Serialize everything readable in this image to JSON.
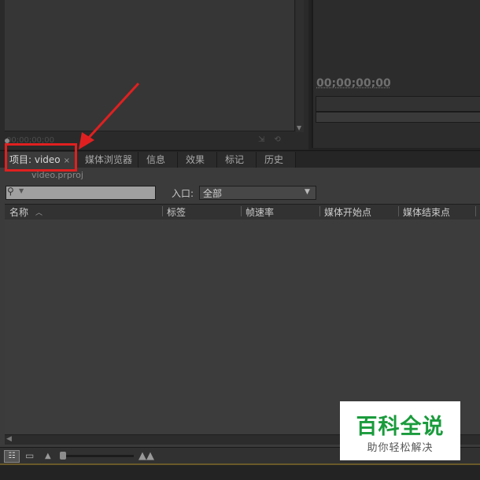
{
  "source_monitor": {
    "timecode": "00;00;00;00"
  },
  "program_monitor": {
    "timecode": "00;00;00;00"
  },
  "tabs": [
    {
      "label": "项目: video",
      "close": "×"
    },
    {
      "label": "媒体浏览器"
    },
    {
      "label": "信息"
    },
    {
      "label": "效果"
    },
    {
      "label": "标记"
    },
    {
      "label": "历史"
    }
  ],
  "project": {
    "file_name": "video.prproj",
    "search_placeholder": "",
    "entry_label": "入口:",
    "entry_value": "全部",
    "columns": [
      "名称",
      "标签",
      "帧速率",
      "媒体开始点",
      "媒体结束点"
    ]
  },
  "watermark": {
    "title": "百科全说",
    "subtitle": "助你轻松解决"
  },
  "colors": {
    "highlight": "#e02020",
    "watermark_green": "#1a9b3c"
  }
}
